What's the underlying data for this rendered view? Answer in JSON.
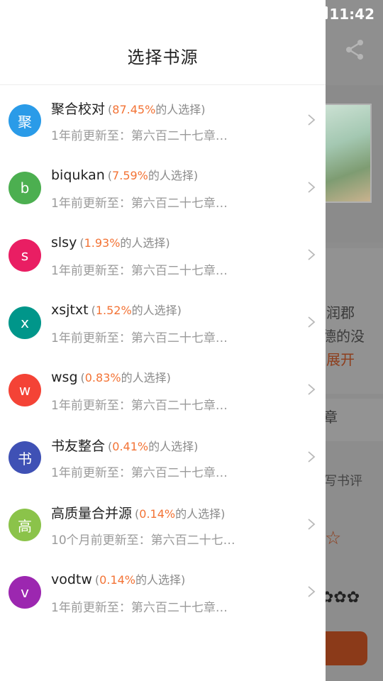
{
  "status_bar": {
    "time": "11:42"
  },
  "background": {
    "snippets": [
      "润郡",
      "德的没",
      "展开",
      "章",
      "写书评"
    ]
  },
  "drawer": {
    "title": "选择书源",
    "items": [
      {
        "avatar": "聚",
        "avatar_color": "#2a9be8",
        "name": "聚合校对",
        "percent": "87.45%",
        "suffix": "的人选择)",
        "prefix": "(",
        "update": "1年前更新至：第六百二十七章…"
      },
      {
        "avatar": "b",
        "avatar_color": "#4caf50",
        "name": "biqukan",
        "percent": "7.59%",
        "suffix": "的人选择)",
        "prefix": "(",
        "update": "1年前更新至：第六百二十七章…"
      },
      {
        "avatar": "s",
        "avatar_color": "#e91e63",
        "name": "slsy",
        "percent": "1.93%",
        "suffix": "的人选择)",
        "prefix": "(",
        "update": "1年前更新至：第六百二十七章…"
      },
      {
        "avatar": "x",
        "avatar_color": "#00968a",
        "name": "xsjtxt",
        "percent": "1.52%",
        "suffix": "的人选择)",
        "prefix": "(",
        "update": "1年前更新至：第六百二十七章…"
      },
      {
        "avatar": "w",
        "avatar_color": "#f44336",
        "name": "wsg",
        "percent": "0.83%",
        "suffix": "的人选择)",
        "prefix": "(",
        "update": "1年前更新至：第六百二十七章…"
      },
      {
        "avatar": "书",
        "avatar_color": "#3f51b5",
        "name": "书友整合",
        "percent": "0.41%",
        "suffix": "的人选择)",
        "prefix": "(",
        "update": "1年前更新至：第六百二十七章…"
      },
      {
        "avatar": "高",
        "avatar_color": "#8bc34a",
        "name": "高质量合并源",
        "percent": "0.14%",
        "suffix": "的人选择)",
        "prefix": "(",
        "update": "10个月前更新至：第六百二十七…"
      },
      {
        "avatar": "v",
        "avatar_color": "#9c27b0",
        "name": "vodtw",
        "percent": "0.14%",
        "suffix": "的人选择)",
        "prefix": "(",
        "update": "1年前更新至：第六百二十七章…"
      }
    ]
  }
}
